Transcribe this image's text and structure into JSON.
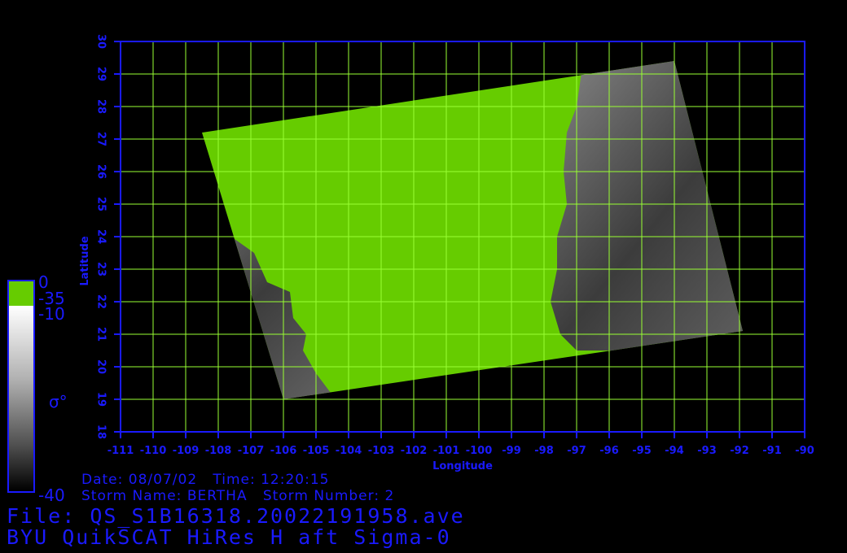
{
  "map": {
    "x_axis_label": "Longitude",
    "y_axis_label": "Latitude",
    "lon_ticks": [
      "-111",
      "-110",
      "-109",
      "-108",
      "-107",
      "-106",
      "-105",
      "-104",
      "-103",
      "-102",
      "-101",
      "-100",
      "-99",
      "-98",
      "-97",
      "-96",
      "-95",
      "-94",
      "-93",
      "-92",
      "-91",
      "-90"
    ],
    "lat_ticks": [
      "18",
      "19",
      "20",
      "21",
      "22",
      "23",
      "24",
      "25",
      "26",
      "27",
      "28",
      "29",
      "30"
    ],
    "lon_range": [
      -111,
      -90
    ],
    "lat_range": [
      18,
      30
    ],
    "land_color": "#66cc00",
    "grid_color": "#99ff33",
    "axis_color": "#1a1aff",
    "swath": {
      "corners": [
        [
          -108.5,
          27.2
        ],
        [
          -94.0,
          29.4
        ],
        [
          -91.9,
          21.1
        ],
        [
          -106.0,
          19.0
        ]
      ]
    }
  },
  "colorbar": {
    "label_top": "0",
    "label_green_bottom": "-35",
    "label_gray_top": "-10",
    "label_bottom": "-40",
    "symbol": "σ°"
  },
  "info": {
    "date_label": "Date:",
    "date_value": "08/07/02",
    "time_label": "Time:",
    "time_value": "12:20:15",
    "storm_name_label": "Storm Name:",
    "storm_name_value": "BERTHA",
    "storm_number_label": "Storm Number:",
    "storm_number_value": "2",
    "file_label": "File:",
    "file_value": "QS_S1B16318.20022191958.ave",
    "product": "BYU QuikSCAT HiRes H aft Sigma-0"
  }
}
